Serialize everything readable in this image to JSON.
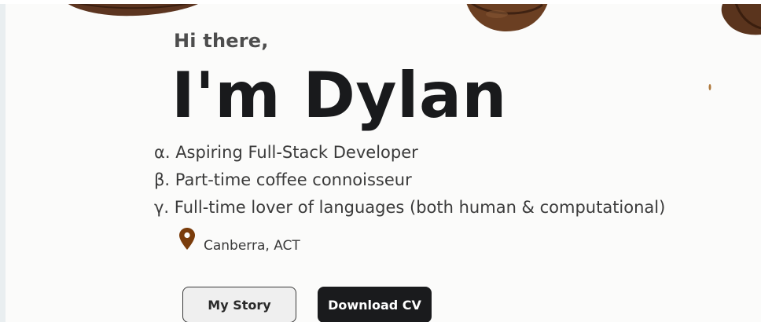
{
  "hero": {
    "greeting": "Hi there,",
    "headline": "I'm Dylan",
    "taglines": [
      "α. Aspiring Full-Stack Developer",
      "β. Part-time coffee connoisseur",
      "γ. Full-time lover of languages (both human & computational)"
    ],
    "location": {
      "icon": "map-pin-icon",
      "text": "Canberra, ACT"
    }
  },
  "actions": {
    "story_label": "My Story",
    "cv_label": "Download CV"
  },
  "colors": {
    "pin": "#7a3c0b",
    "coffee_bean": "#6b3f22",
    "button_dark": "#1a1b1d",
    "button_light": "#efefef"
  }
}
